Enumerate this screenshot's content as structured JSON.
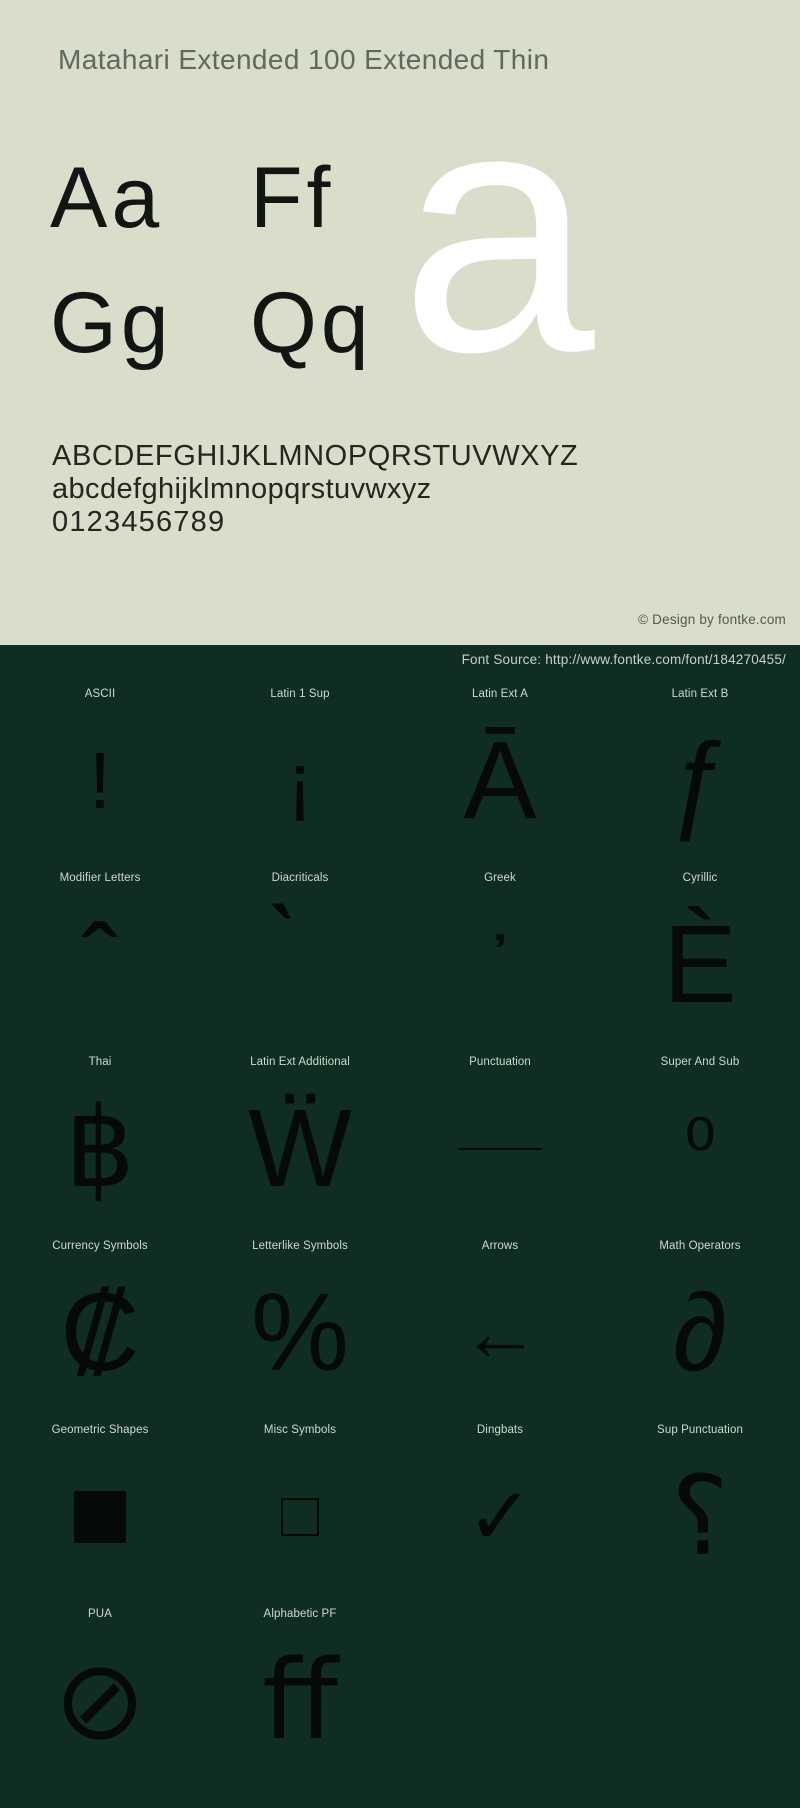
{
  "specimen": {
    "title": "Matahari Extended 100 Extended Thin",
    "hero_glyph": "a",
    "letter_pairs": [
      {
        "label": "Aa"
      },
      {
        "label": "Ff"
      },
      {
        "label": "Gg"
      },
      {
        "label": "Qq"
      }
    ],
    "alphabet_uppercase": "ABCDEFGHIJKLMNOPQRSTUVWXYZ",
    "alphabet_lowercase": "abcdefghijklmnopqrstuvwxyz",
    "digits": "0123456789",
    "copyright": "© Design by fontke.com"
  },
  "coverage": {
    "font_source": "Font Source: http://www.fontke.com/font/184270455/",
    "blocks": [
      {
        "label": "ASCII",
        "sample": "!",
        "size": "sm"
      },
      {
        "label": "Latin 1 Sup",
        "sample": "¡",
        "size": "sm"
      },
      {
        "label": "Latin Ext A",
        "sample": "Ā",
        "size": "lg"
      },
      {
        "label": "Latin Ext B",
        "sample": "ƒ",
        "size": "lg"
      },
      {
        "label": "Modifier Letters",
        "sample": "ˆ",
        "size": "lg"
      },
      {
        "label": "Diacriticals",
        "sample": "̀",
        "size": "lg"
      },
      {
        "label": "Greek",
        "sample": "᾽",
        "size": "sm"
      },
      {
        "label": "Cyrillic",
        "sample": "Ѐ",
        "size": "lg"
      },
      {
        "label": "Thai",
        "sample": "฿",
        "size": "lg"
      },
      {
        "label": "Latin Ext Additional",
        "sample": "Ẅ",
        "size": "lg"
      },
      {
        "label": "Punctuation",
        "sample": "—",
        "size": "dash"
      },
      {
        "label": "Super And Sub",
        "sample": "⁰",
        "size": "sm"
      },
      {
        "label": "Currency Symbols",
        "sample": "₡",
        "size": "lg"
      },
      {
        "label": "Letterlike Symbols",
        "sample": "%",
        "size": "lg"
      },
      {
        "label": "Arrows",
        "sample": "←",
        "size": "sm"
      },
      {
        "label": "Math Operators",
        "sample": "∂",
        "size": "lg"
      },
      {
        "label": "Geometric Shapes",
        "sample": "■",
        "size": "sq-filled"
      },
      {
        "label": "Misc Symbols",
        "sample": "□",
        "size": "sq-open"
      },
      {
        "label": "Dingbats",
        "sample": "✓",
        "size": "sm"
      },
      {
        "label": "Sup Punctuation",
        "sample": "⸮",
        "size": "lg"
      },
      {
        "label": "PUA",
        "sample": "⊘",
        "size": "lg"
      },
      {
        "label": "Alphabetic PF",
        "sample": "ﬀ",
        "size": "lg"
      }
    ]
  },
  "colors": {
    "specimen_bg": "#d9ddca",
    "coverage_bg": "#0f2d22",
    "title_text": "#5c6b5e",
    "glyph_dark": "#050a07",
    "hero_white": "#ffffff",
    "label_text": "#cfdacb"
  }
}
